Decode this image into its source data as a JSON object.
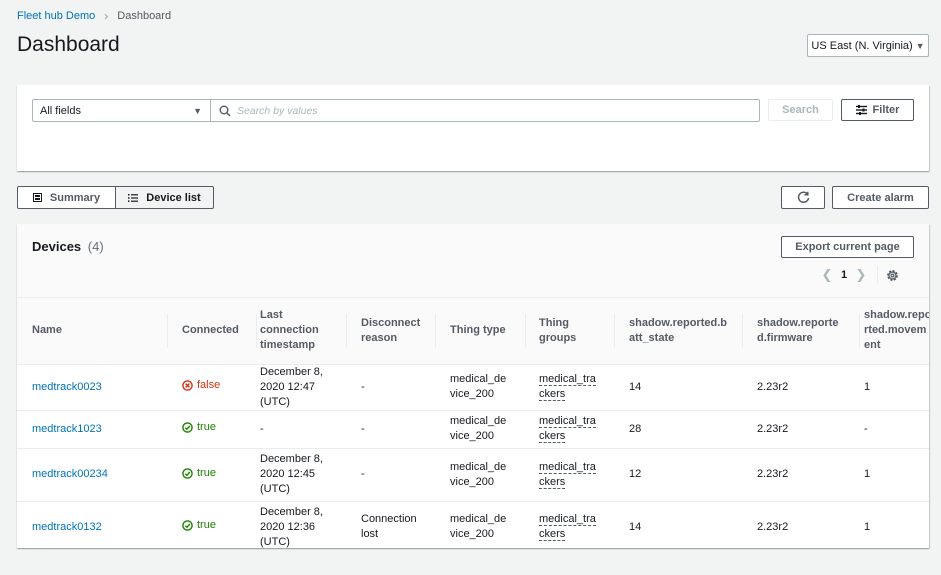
{
  "breadcrumb": {
    "items": [
      {
        "label": "Fleet hub Demo",
        "link": true
      },
      {
        "label": "Dashboard",
        "link": false
      }
    ]
  },
  "header": {
    "title": "Dashboard",
    "region": "US East (N. Virginia)"
  },
  "filter": {
    "field_select": "All fields",
    "search_placeholder": "Search by values",
    "search_value": "",
    "search_button": "Search",
    "filter_button": "Filter"
  },
  "view_toggle": {
    "options": [
      {
        "label": "Summary",
        "icon": "summary-grid-icon",
        "selected": false
      },
      {
        "label": "Device list",
        "icon": "list-icon",
        "selected": true
      }
    ]
  },
  "actions": {
    "refresh_icon": "refresh-icon",
    "create_alarm": "Create alarm"
  },
  "devices": {
    "title": "Devices",
    "count": "(4)",
    "export_button": "Export current page",
    "pagination": {
      "current_page": "1"
    },
    "columns": [
      "Name",
      "Connected",
      "Last connection timestamp",
      "Disconnect reason",
      "Thing type",
      "Thing groups",
      "shadow.reported.batt_state",
      "shadow.reported.firmware",
      "shadow.reported.movement"
    ],
    "rows": [
      {
        "name": "medtrack0023",
        "connected": "false",
        "timestamp": "December 8, 2020 12:47 (UTC)",
        "disconnect_reason": "-",
        "thing_type": "medical_device_200",
        "thing_groups": "medical_trackers",
        "batt_state": "14",
        "firmware": "2.23r2",
        "movement": "1"
      },
      {
        "name": "medtrack1023",
        "connected": "true",
        "timestamp": "-",
        "disconnect_reason": "-",
        "thing_type": "medical_device_200",
        "thing_groups": "medical_trackers",
        "batt_state": "28",
        "firmware": "2.23r2",
        "movement": "-"
      },
      {
        "name": "medtrack00234",
        "connected": "true",
        "timestamp": "December 8, 2020 12:45 (UTC)",
        "disconnect_reason": "-",
        "thing_type": "medical_device_200",
        "thing_groups": "medical_trackers",
        "batt_state": "12",
        "firmware": "2.23r2",
        "movement": "1"
      },
      {
        "name": "medtrack0132",
        "connected": "true",
        "timestamp": "December 8, 2020 12:36 (UTC)",
        "disconnect_reason": "Connection lost",
        "thing_type": "medical_device_200",
        "thing_groups": "medical_trackers",
        "batt_state": "14",
        "firmware": "2.23r2",
        "movement": "1"
      }
    ]
  },
  "colors": {
    "link": "#0073bb",
    "status_true": "#1d8102",
    "status_false": "#d13212",
    "background": "#f2f3f3"
  }
}
